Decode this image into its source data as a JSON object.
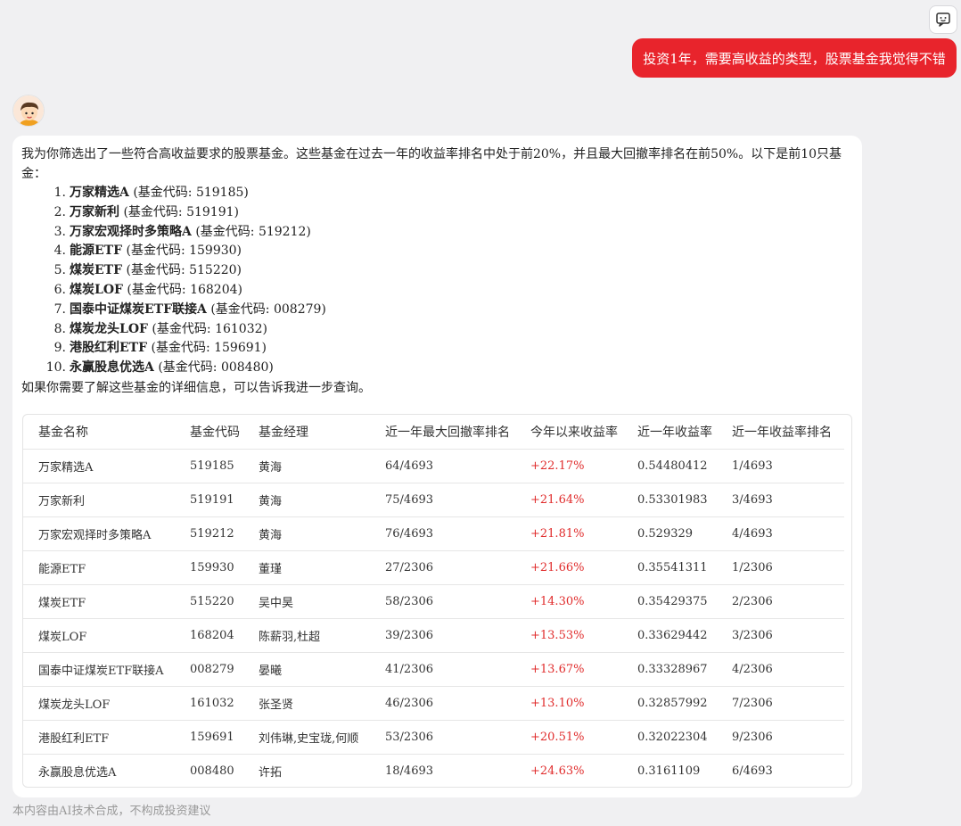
{
  "user_message": "投资1年，需要高收益的类型，股票基金我觉得不错",
  "intro_text": "我为你筛选出了一些符合高收益要求的股票基金。这些基金在过去一年的收益率排名中处于前20%，并且最大回撤率排名在前50%。以下是前10只基金：",
  "fund_list": [
    {
      "num": "1.",
      "name": "万家精选A",
      "code_text": " (基金代码: 519185)"
    },
    {
      "num": "2.",
      "name": "万家新利",
      "code_text": " (基金代码: 519191)"
    },
    {
      "num": "3.",
      "name": "万家宏观择时多策略A",
      "code_text": " (基金代码: 519212)"
    },
    {
      "num": "4.",
      "name": "能源ETF",
      "code_text": " (基金代码: 159930)"
    },
    {
      "num": "5.",
      "name": "煤炭ETF",
      "code_text": " (基金代码: 515220)"
    },
    {
      "num": "6.",
      "name": "煤炭LOF",
      "code_text": " (基金代码: 168204)"
    },
    {
      "num": "7.",
      "name": "国泰中证煤炭ETF联接A",
      "code_text": " (基金代码: 008279)"
    },
    {
      "num": "8.",
      "name": "煤炭龙头LOF",
      "code_text": " (基金代码: 161032)"
    },
    {
      "num": "9.",
      "name": "港股红利ETF",
      "code_text": " (基金代码: 159691)"
    },
    {
      "num": "10.",
      "name": "永赢股息优选A",
      "code_text": " (基金代码: 008480)"
    }
  ],
  "outro_text": "如果你需要了解这些基金的详细信息，可以告诉我进一步查询。",
  "table": {
    "headers": [
      "基金名称",
      "基金代码",
      "基金经理",
      "近一年最大回撤率排名",
      "今年以来收益率",
      "近一年收益率",
      "近一年收益率排名"
    ],
    "rows": [
      [
        "万家精选A",
        "519185",
        "黄海",
        "64/4693",
        "+22.17%",
        "0.54480412",
        "1/4693"
      ],
      [
        "万家新利",
        "519191",
        "黄海",
        "75/4693",
        "+21.64%",
        "0.53301983",
        "3/4693"
      ],
      [
        "万家宏观择时多策略A",
        "519212",
        "黄海",
        "76/4693",
        "+21.81%",
        "0.529329",
        "4/4693"
      ],
      [
        "能源ETF",
        "159930",
        "董瑾",
        "27/2306",
        "+21.66%",
        "0.35541311",
        "1/2306"
      ],
      [
        "煤炭ETF",
        "515220",
        "吴中昊",
        "58/2306",
        "+14.30%",
        "0.35429375",
        "2/2306"
      ],
      [
        "煤炭LOF",
        "168204",
        "陈薪羽,杜超",
        "39/2306",
        "+13.53%",
        "0.33629442",
        "3/2306"
      ],
      [
        "国泰中证煤炭ETF联接A",
        "008279",
        "晏曦",
        "41/2306",
        "+13.67%",
        "0.33328967",
        "4/2306"
      ],
      [
        "煤炭龙头LOF",
        "161032",
        "张圣贤",
        "46/2306",
        "+13.10%",
        "0.32857992",
        "7/2306"
      ],
      [
        "港股红利ETF",
        "159691",
        "刘伟琳,史宝珑,何顺",
        "53/2306",
        "+20.51%",
        "0.32022304",
        "9/2306"
      ],
      [
        "永赢股息优选A",
        "008480",
        "许拓",
        "18/4693",
        "+24.63%",
        "0.3161109",
        "6/4693"
      ]
    ]
  },
  "disclaimer": "本内容由AI技术合成，不构成投资建议",
  "colors": {
    "accent_red": "#e8242c",
    "return_red": "#e02b2b"
  },
  "icons": {
    "top_right": "feedback-icon",
    "avatar": "assistant-avatar"
  }
}
